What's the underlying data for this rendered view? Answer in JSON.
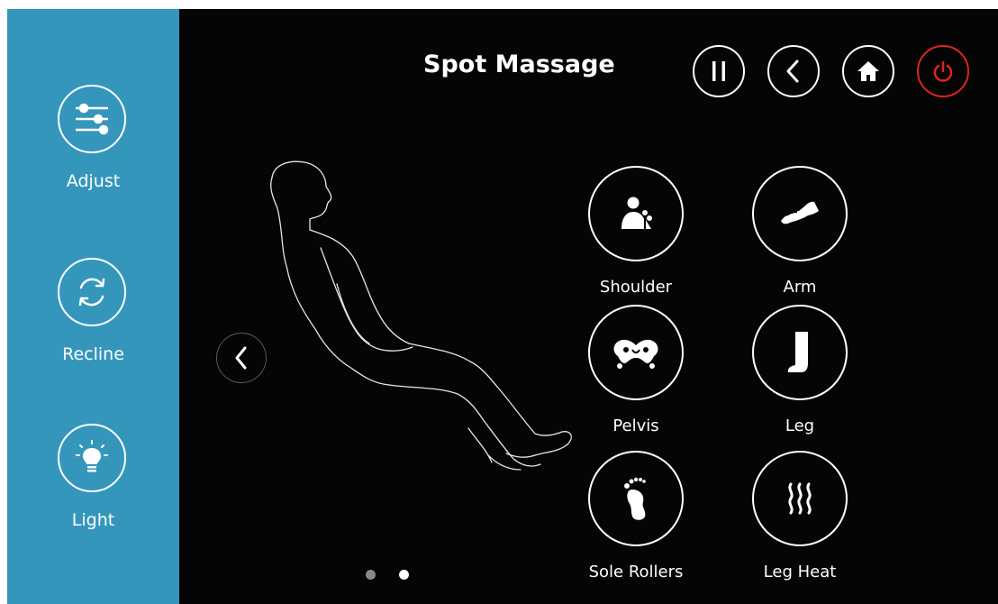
{
  "header": {
    "title": "Spot Massage"
  },
  "sidebar": {
    "items": [
      {
        "label": "Adjust",
        "icon": "sliders-icon"
      },
      {
        "label": "Recline",
        "icon": "recline-arrows-icon"
      },
      {
        "label": "Light",
        "icon": "lightbulb-icon"
      }
    ]
  },
  "toolbar": {
    "buttons": [
      {
        "name": "pause",
        "icon": "pause-icon"
      },
      {
        "name": "back",
        "icon": "back-chevron-icon"
      },
      {
        "name": "home",
        "icon": "home-icon"
      },
      {
        "name": "power",
        "icon": "power-icon"
      }
    ]
  },
  "areas": [
    {
      "label": "Shoulder",
      "icon": "shoulder-icon"
    },
    {
      "label": "Arm",
      "icon": "arm-icon"
    },
    {
      "label": "Pelvis",
      "icon": "pelvis-icon"
    },
    {
      "label": "Leg",
      "icon": "leg-icon"
    },
    {
      "label": "Sole Rollers",
      "icon": "foot-icon"
    },
    {
      "label": "Leg Heat",
      "icon": "heat-icon"
    }
  ],
  "pagination": {
    "pages": 2,
    "current": 2
  },
  "colors": {
    "sidebar": "#3596bc",
    "background": "#050505",
    "power": "#e0251e",
    "foreground": "#ffffff"
  }
}
